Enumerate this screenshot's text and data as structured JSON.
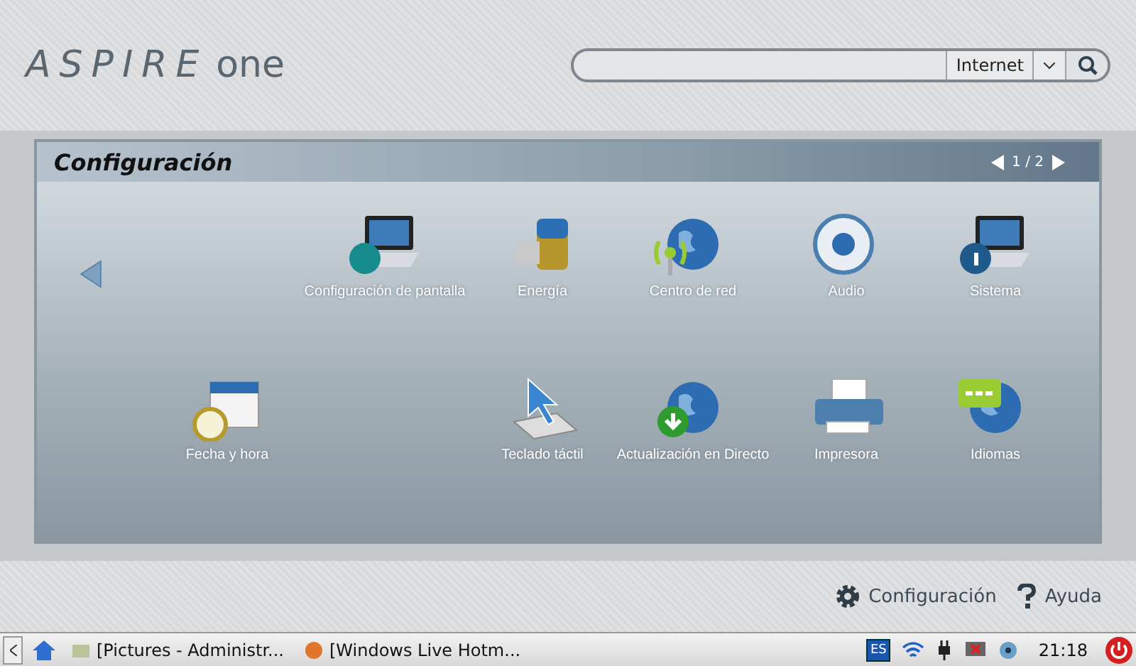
{
  "header": {
    "logo": {
      "brand": "ASPIRE",
      "suffix": "one"
    },
    "search": {
      "scope": "Internet"
    }
  },
  "panel": {
    "title": "Configuración",
    "pager": "1 / 2",
    "rows": [
      [
        {
          "label": "Configuración de pantalla"
        },
        {
          "label": "Energía"
        },
        {
          "label": "Centro de red"
        },
        {
          "label": "Audio"
        },
        {
          "label": "Sistema"
        }
      ],
      [
        {
          "label": "Fecha y hora"
        },
        {
          "label": "Teclado táctil"
        },
        {
          "label": "Actualización en Directo"
        },
        {
          "label": "Impresora"
        },
        {
          "label": "Idiomas"
        }
      ]
    ]
  },
  "footer": {
    "links": [
      {
        "label": "Configuración"
      },
      {
        "label": "Ayuda"
      }
    ]
  },
  "taskbar": {
    "tasks": [
      {
        "label": "[Pictures - Administr..."
      },
      {
        "label": "[Windows Live Hotm..."
      }
    ],
    "language": "ES",
    "clock": "21:18"
  }
}
